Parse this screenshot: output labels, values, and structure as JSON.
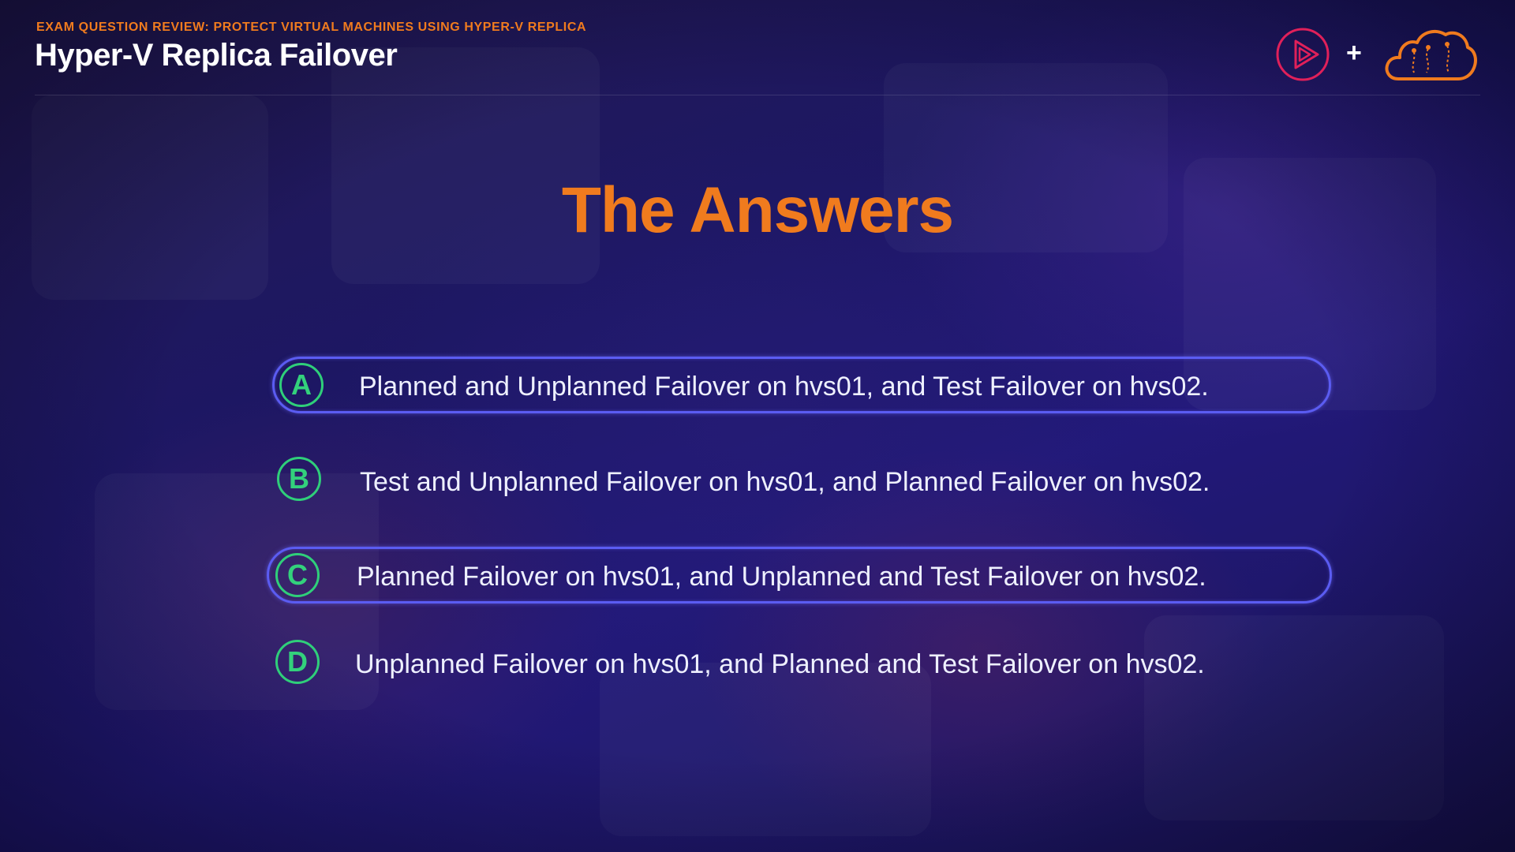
{
  "header": {
    "kicker": "EXAM QUESTION REVIEW: PROTECT VIRTUAL MACHINES USING HYPER-V REPLICA",
    "title": "Hyper-V Replica Failover",
    "plus": "+",
    "logos": [
      "play-logo",
      "cloud-logo"
    ]
  },
  "heading": "The Answers",
  "options": [
    {
      "letter": "A",
      "text": "Planned and Unplanned Failover on hvs01, and Test Failover on hvs02.",
      "highlighted": true
    },
    {
      "letter": "B",
      "text": "Test and Unplanned Failover on hvs01, and Planned Failover on hvs02.",
      "highlighted": false
    },
    {
      "letter": "C",
      "text": "Planned Failover on hvs01, and Unplanned and Test Failover on hvs02.",
      "highlighted": true
    },
    {
      "letter": "D",
      "text": "Unplanned Failover on hvs01, and Planned and Test Failover on hvs02.",
      "highlighted": false
    }
  ],
  "colors": {
    "accent_orange": "#f07b1e",
    "badge_green": "#2fcf7a",
    "highlight_blue": "#5b5cf2",
    "play_logo_red": "#e0205a"
  }
}
